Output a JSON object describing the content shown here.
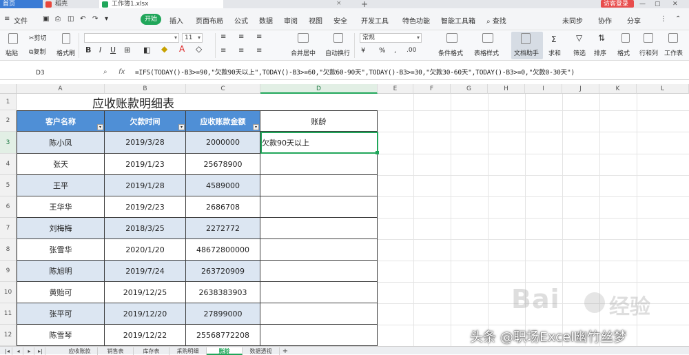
{
  "colors": {
    "accent": "#20a65a",
    "header_fill": "#4f8fd6",
    "band_fill": "#dce6f2",
    "tab_blue": "#3a7bd5"
  },
  "tabbar": {
    "home_label": "首页",
    "tabs": [
      {
        "label": "稻壳",
        "icon": "docer-icon"
      },
      {
        "label": "工作簿1.xlsx",
        "icon": "spreadsheet-icon"
      }
    ],
    "login_label": "访客登录"
  },
  "menubar": {
    "file": "文件",
    "start_btn": "开始",
    "items": [
      "插入",
      "页面布局",
      "公式",
      "数据",
      "审阅",
      "视图",
      "安全",
      "开发工具",
      "特色功能",
      "智能工具箱"
    ],
    "search": "查找",
    "right": [
      "未同步",
      "协作",
      "分享"
    ]
  },
  "ribbon": {
    "paste": "粘贴",
    "cut": "剪切",
    "copy": "复制",
    "format_painter": "格式刷",
    "font_size": "11",
    "merge_center": "合并居中",
    "wrap": "自动换行",
    "number_format": "常规",
    "cond_format": "条件格式",
    "table_style": "表格样式",
    "doc_helper": "文档助手",
    "sum": "求和",
    "filter": "筛选",
    "sort": "排序",
    "format": "格式",
    "rows_cols": "行和列",
    "worksheet": "工作表"
  },
  "formula_bar": {
    "name_box": "D3",
    "formula": "=IFS(TODAY()-B3>=90,\"欠款90天以上\",TODAY()-B3>=60,\"欠款60-90天\",TODAY()-B3>=30,\"欠款30-60天\",TODAY()-B3>=0,\"欠款0-30天\")"
  },
  "columns": [
    "A",
    "B",
    "C",
    "D",
    "E",
    "F",
    "G",
    "H",
    "I",
    "J",
    "K",
    "L"
  ],
  "rows": [
    "1",
    "2",
    "3",
    "4",
    "5",
    "6",
    "7",
    "8",
    "9",
    "10",
    "11",
    "12"
  ],
  "table": {
    "title": "应收账款明细表",
    "headers": [
      "客户名称",
      "欠款时间",
      "应收账款金额",
      "账龄"
    ],
    "rows": [
      {
        "name": "陈小凤",
        "date": "2019/3/28",
        "amount": "2000000",
        "aging": "欠款90天以上"
      },
      {
        "name": "张天",
        "date": "2019/1/23",
        "amount": "25678900",
        "aging": ""
      },
      {
        "name": "王平",
        "date": "2019/1/28",
        "amount": "4589000",
        "aging": ""
      },
      {
        "name": "王华华",
        "date": "2019/2/23",
        "amount": "2686708",
        "aging": ""
      },
      {
        "name": "刘梅梅",
        "date": "2018/3/25",
        "amount": "2272772",
        "aging": ""
      },
      {
        "name": "张雪华",
        "date": "2020/1/20",
        "amount": "48672800000",
        "aging": ""
      },
      {
        "name": "陈旭明",
        "date": "2019/7/24",
        "amount": "263720909",
        "aging": ""
      },
      {
        "name": "黄贻可",
        "date": "2019/12/25",
        "amount": "2638383903",
        "aging": ""
      },
      {
        "name": "张平可",
        "date": "2019/12/20",
        "amount": "27899000",
        "aging": ""
      },
      {
        "name": "陈雪琴",
        "date": "2019/12/22",
        "amount": "25568772208",
        "aging": ""
      }
    ]
  },
  "sheets": [
    "应收账款",
    "销售表",
    "库存表",
    "采购明细",
    "账龄",
    "数据透视"
  ],
  "watermark": {
    "baidu": "Bai",
    "jingyan": "经验",
    "author": "头条 @职场Excel幽竹丝梦"
  }
}
